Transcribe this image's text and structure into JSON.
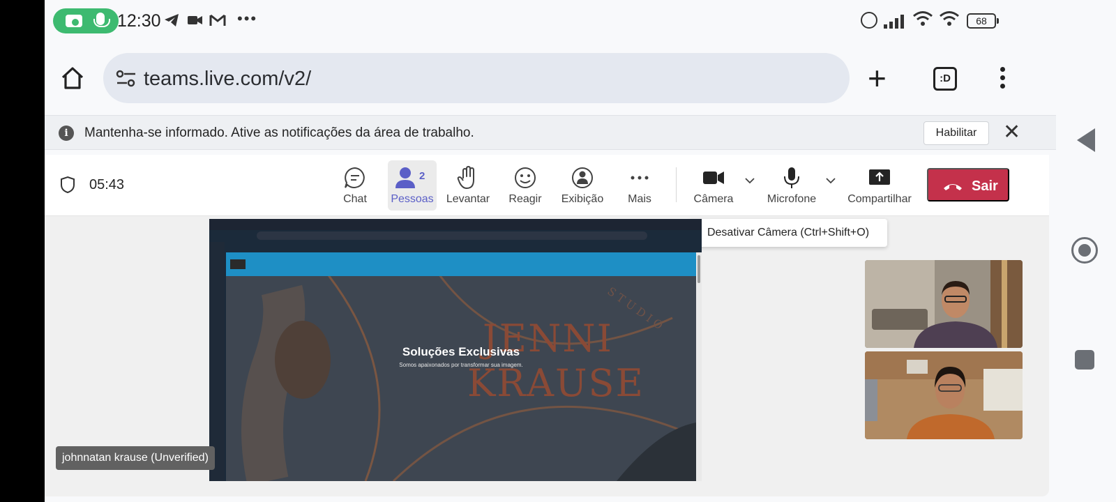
{
  "status_bar": {
    "time": "12:30",
    "battery": "68",
    "icons": [
      "camera-icon",
      "mic-icon",
      "telegram-icon",
      "video-icon",
      "gmail-icon",
      "alarm-icon",
      "signal-icon",
      "wifi-icon",
      "battery-icon"
    ]
  },
  "browser": {
    "url": "teams.live.com/v2/",
    "tabs_label": ":D"
  },
  "banner": {
    "message": "Mantenha-se informado. Ative as notificações da área de trabalho.",
    "enable_label": "Habilitar"
  },
  "meeting": {
    "timer": "05:43",
    "toolbar": {
      "chat": "Chat",
      "people": "Pessoas",
      "people_count": "2",
      "raise": "Levantar",
      "react": "Reagir",
      "view": "Exibição",
      "more": "Mais",
      "camera": "Câmera",
      "mic": "Microfone",
      "share": "Compartilhar",
      "leave": "Sair"
    },
    "tooltip": "Desativar Câmera (Ctrl+Shift+O)",
    "presenter_name": "johnnatan krause (Unverified)",
    "shared_screen": {
      "hero_title": "Soluções Exclusivas",
      "hero_subtitle": "Somos apaixonados por transformar sua imagem.",
      "brand_line1": "JENNI",
      "brand_line2": "KRAUSE",
      "brand_tag": "STUDIO"
    }
  },
  "colors": {
    "accent": "#5b5fc7",
    "leave": "#c4314b",
    "recording": "#3dba70"
  }
}
